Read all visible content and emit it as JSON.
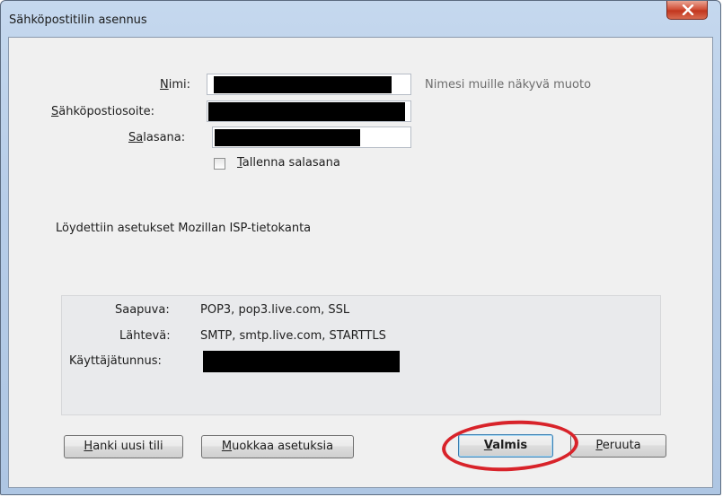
{
  "window": {
    "title": "Sähköpostitilin asennus"
  },
  "form": {
    "name_label_prefix": "N",
    "name_label_rest": "imi:",
    "name_hint": "Nimesi muille näkyvä muoto",
    "email_label_prefix": "S",
    "email_label_rest": "ähköpostiosoite:",
    "password_label_prefix": "S",
    "password_label_mid": "a",
    "password_label_rest": "lasana:",
    "remember_prefix": "T",
    "remember_rest": "allenna salasana",
    "remember_checked": false
  },
  "status": {
    "message": "Löydettiin asetukset Mozillan ISP-tietokanta"
  },
  "settings": {
    "incoming_label": "Saapuva:",
    "incoming_value": "POP3, pop3.live.com, SSL",
    "outgoing_label": "Lähtevä:",
    "outgoing_value": "SMTP, smtp.live.com, STARTTLS",
    "username_label": "Käyttäjätunnus:"
  },
  "buttons": {
    "new_account_prefix": "H",
    "new_account_rest": "anki uusi tili",
    "edit_settings_prefix": "M",
    "edit_settings_rest": "uokkaa asetuksia",
    "done_prefix": "V",
    "done_rest": "almis",
    "cancel_prefix": "P",
    "cancel_rest": "eruuta"
  },
  "annotation": {
    "ring_color": "#d8232a"
  }
}
